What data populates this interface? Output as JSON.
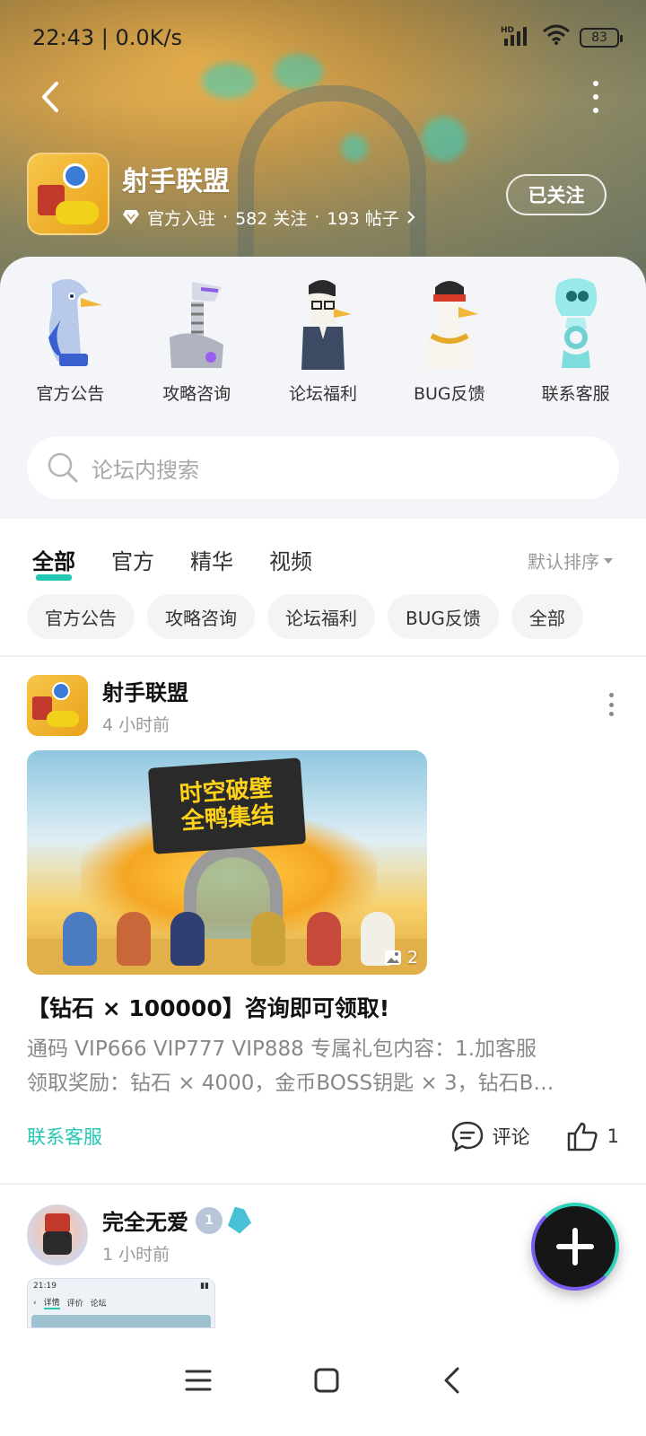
{
  "status_bar": {
    "time": "22:43 | 0.0K/s",
    "network": "HD",
    "battery": "83"
  },
  "forum": {
    "name": "射手联盟",
    "badge": "官方入驻",
    "followers": "582 关注",
    "posts": "193 帖子",
    "follow_button": "已关注"
  },
  "categories": [
    {
      "label": "官方公告",
      "icon": "pigeon-icon"
    },
    {
      "label": "攻略咨询",
      "icon": "robot-icon"
    },
    {
      "label": "论坛福利",
      "icon": "goose-glasses-icon"
    },
    {
      "label": "BUG反馈",
      "icon": "goose-headband-icon"
    },
    {
      "label": "联系客服",
      "icon": "ghost-duck-icon"
    }
  ],
  "search": {
    "placeholder": "论坛内搜索"
  },
  "tabs": [
    "全部",
    "官方",
    "精华",
    "视频"
  ],
  "active_tab": "全部",
  "sort_label": "默认排序",
  "chips": [
    "官方公告",
    "攻略咨询",
    "论坛福利",
    "BUG反馈",
    "全部"
  ],
  "post1": {
    "author": "射手联盟",
    "time": "4 小时前",
    "image_title_line1": "时空破壁",
    "image_title_line2": "全鸭集结",
    "image_count": "2",
    "title": "【钻石 × 100000】咨询即可领取!",
    "excerpt_line1": "通码 VIP666 VIP777 VIP888 专属礼包内容：1.加客服",
    "excerpt_line2": "领取奖励：钻石 × 4000，金币BOSS钥匙 × 3，钻石B…",
    "tag": "联系客服",
    "comment_label": "评论",
    "like_count": "1"
  },
  "post2": {
    "author": "完全无爱",
    "level_badge": "1",
    "time": "1 小时前",
    "thumb_time": "21:19",
    "thumb_tab1": "详情",
    "thumb_tab2": "评价",
    "thumb_tab3": "论坛"
  },
  "colors": {
    "accent": "#22c8b4",
    "text_muted": "#999999"
  }
}
